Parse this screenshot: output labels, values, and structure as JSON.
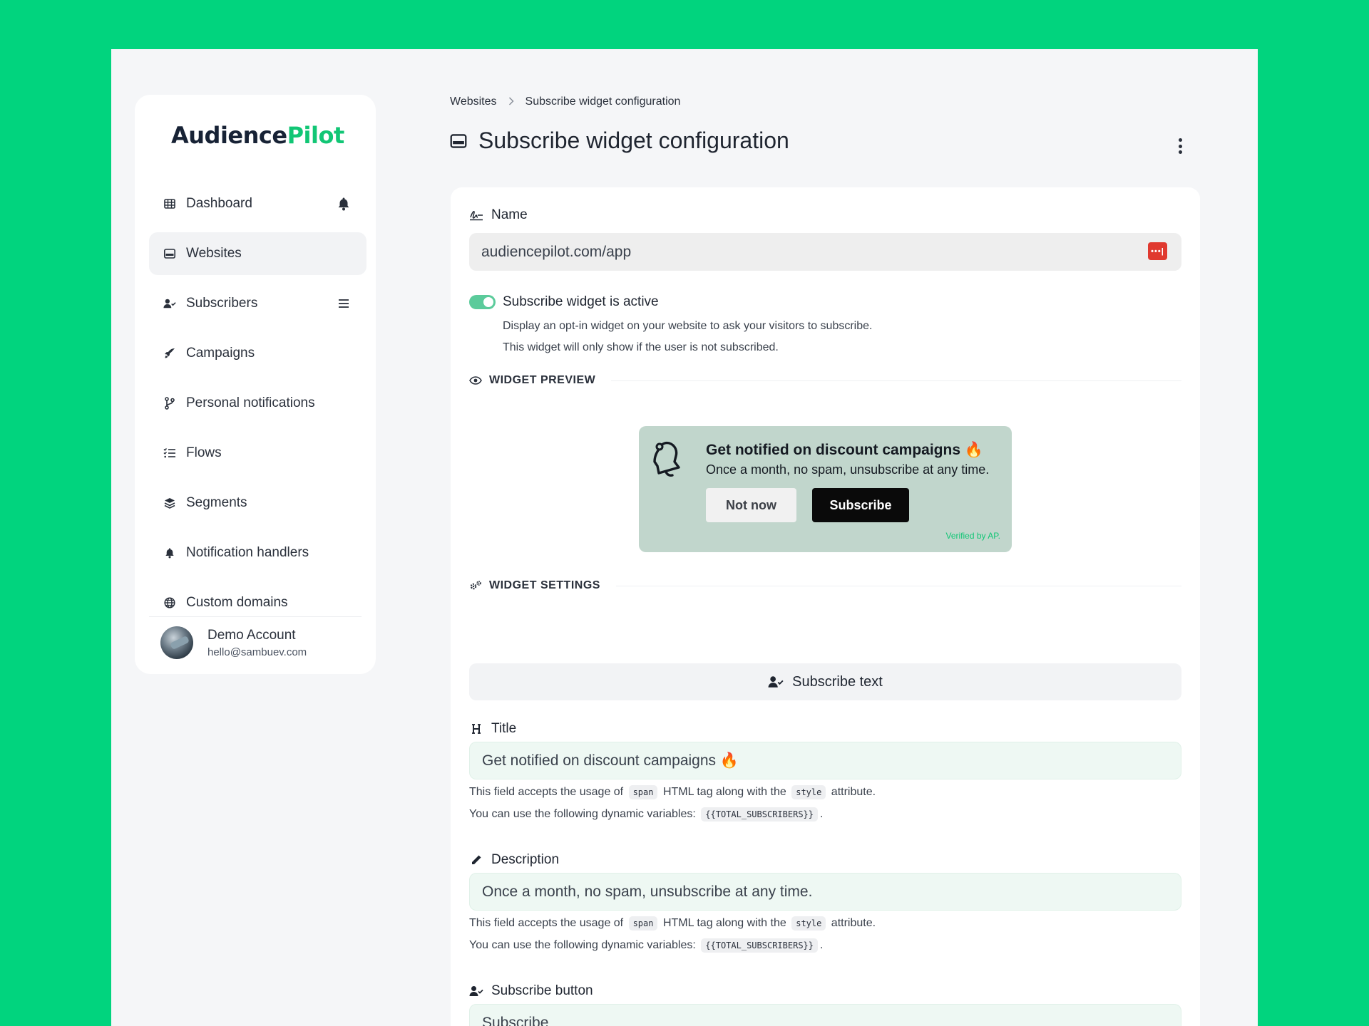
{
  "brand": {
    "part1": "Audience",
    "part2": "Pilot"
  },
  "sidebar": {
    "items": [
      {
        "label": "Dashboard",
        "icon": "table-icon",
        "right_icon": "bell-icon"
      },
      {
        "label": "Websites",
        "icon": "websites-icon",
        "active": true
      },
      {
        "label": "Subscribers",
        "icon": "user-check-icon",
        "right_icon": "menu-icon"
      },
      {
        "label": "Campaigns",
        "icon": "rocket-icon"
      },
      {
        "label": "Personal notifications",
        "icon": "branch-icon"
      },
      {
        "label": "Flows",
        "icon": "list-check-icon"
      },
      {
        "label": "Segments",
        "icon": "layers-icon"
      },
      {
        "label": "Notification handlers",
        "icon": "bell-icon"
      },
      {
        "label": "Custom domains",
        "icon": "globe-icon"
      }
    ],
    "account": {
      "name": "Demo Account",
      "email": "hello@sambuev.com"
    }
  },
  "breadcrumb": {
    "parent": "Websites",
    "current": "Subscribe widget configuration"
  },
  "page": {
    "title": "Subscribe widget configuration"
  },
  "form": {
    "name_label": "Name",
    "name_value": "audiencepilot.com/app",
    "toggle_label": "Subscribe widget is active",
    "toggle_on": true,
    "toggle_help_1": "Display an opt-in widget on your website to ask your visitors to subscribe.",
    "toggle_help_2": "This widget will only show if the user is not subscribed.",
    "preview_heading": "WIDGET PREVIEW",
    "settings_heading": "WIDGET SETTINGS",
    "tab_label": "Subscribe text",
    "title_label": "Title",
    "title_value": "Get notified on discount campaigns 🔥",
    "description_label": "Description",
    "description_value": "Once a month, no spam, unsubscribe at any time.",
    "subscribe_button_label": "Subscribe button",
    "subscribe_button_value": "Subscribe",
    "help_accepts_pre": "This field accepts the usage of",
    "help_tag": "span",
    "help_accepts_mid": "HTML tag along with the",
    "help_attr": "style",
    "help_accepts_post": "attribute.",
    "help_vars_pre": "You can use the following dynamic variables:",
    "help_var": "{{TOTAL_SUBSCRIBERS}}",
    "help_vars_post": "."
  },
  "preview": {
    "title": "Get notified on discount campaigns 🔥",
    "description": "Once a month, no spam, unsubscribe at any time.",
    "not_now": "Not now",
    "subscribe": "Subscribe",
    "verified": "Verified by AP.",
    "bg_color": "#c1d6cc"
  },
  "colors": {
    "page_bg": "#01d47e",
    "brand_accent": "#11c675",
    "toggle": "#5bcb9b"
  }
}
